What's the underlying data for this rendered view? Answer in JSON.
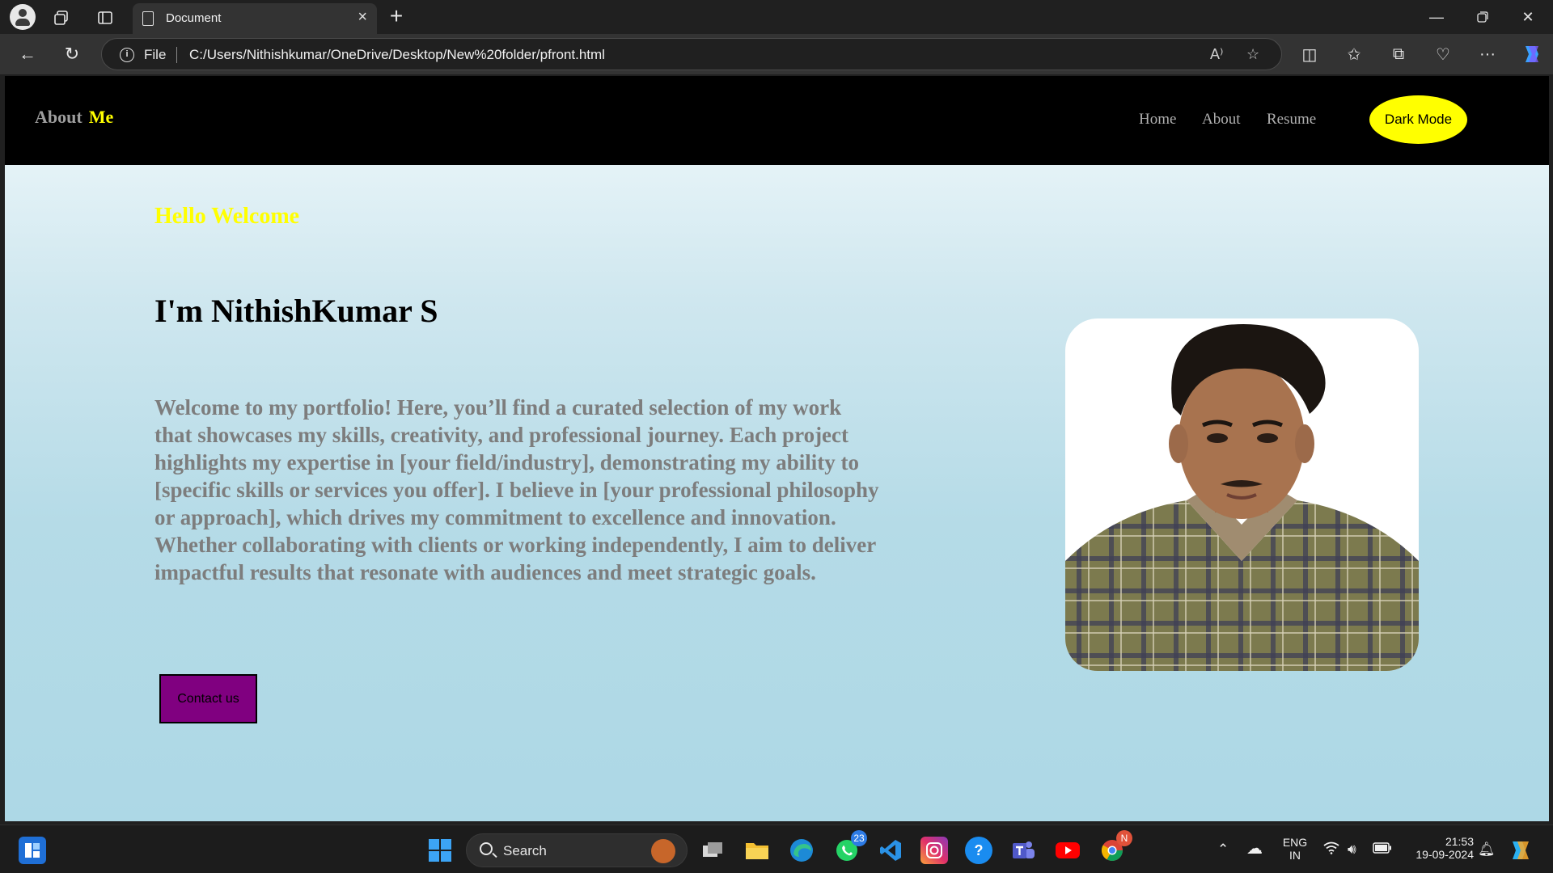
{
  "browser": {
    "tab_title": "Document",
    "new_tab_symbol": "+",
    "address_scheme": "File",
    "address_url": "C:/Users/Nithishkumar/OneDrive/Desktop/New%20folder/pfront.html"
  },
  "site": {
    "logo_primary": "About",
    "logo_accent": "Me",
    "nav": [
      "Home",
      "About",
      "Resume"
    ],
    "dark_mode_label": "Dark Mode",
    "greeting": "Hello Welcome",
    "heading": "I'm NithishKumar S",
    "intro": "Welcome to my portfolio! Here, you’ll find a curated selection of my work that showcases my skills, creativity, and professional journey. Each project highlights my expertise in [your field/industry], demonstrating my ability to [specific skills or services you offer]. I believe in [your professional philosophy or approach], which drives my commitment to excellence and innovation. Whether collaborating with clients or working independently, I aim to deliver impactful results that resonate with audiences and meet strategic goals.",
    "contact_label": "Contact us"
  },
  "taskbar": {
    "search_label": "Search",
    "whatsapp_badge": "23",
    "chrome_badge": "N",
    "language_line1": "ENG",
    "language_line2": "IN",
    "time": "21:53",
    "date": "19-09-2024"
  },
  "colors": {
    "accent_yellow": "#ffff00",
    "contact_purple": "#800080",
    "header_black": "#000000",
    "page_background": "#add8e6"
  }
}
